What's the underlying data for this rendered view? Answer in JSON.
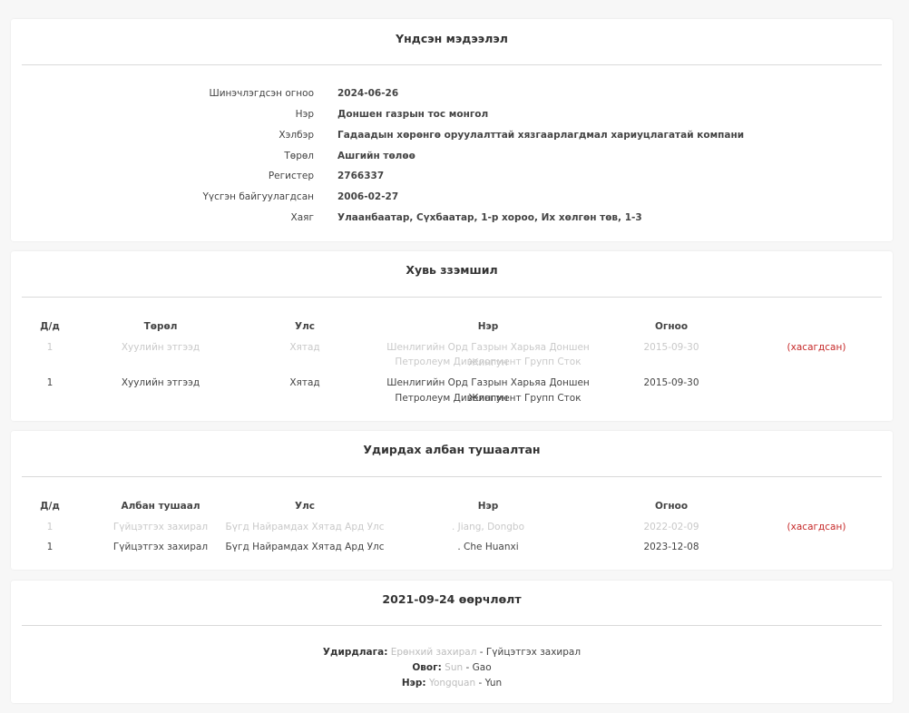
{
  "basic": {
    "title": "Үндсэн мэдээлэл",
    "rows": [
      {
        "label": "Шинэчлэгдсэн огноо",
        "value": "2024-06-26"
      },
      {
        "label": "Нэр",
        "value": "Доншен газрын тос монгол"
      },
      {
        "label": "Хэлбэр",
        "value": "Гадаадын хөрөнгө оруулалттай хязгаарлагдмал хариуцлагатай компани"
      },
      {
        "label": "Төрөл",
        "value": "Ашгийн төлөө"
      },
      {
        "label": "Регистер",
        "value": "2766337"
      },
      {
        "label": "Үүсгэн байгуулагдсан",
        "value": "2006-02-27"
      },
      {
        "label": "Хаяг",
        "value": "Улаанбаатар, Сүхбаатар, 1-р хороо, Их хөлгөн төв, 1-3"
      }
    ]
  },
  "ownership": {
    "title": "Хувь ззэмшил",
    "headers": {
      "dd": "Д/д",
      "type": "Төрөл",
      "country": "Улс",
      "name": "Нэр",
      "date": "Огноо"
    },
    "rows": [
      {
        "dd": "1",
        "type": "Хуулийн этгээд",
        "country": "Хятад",
        "name1": "Шенлигийн Орд Газрын Харьяа Доншен Жингун",
        "name2": "Петролеум Дивелопмент Групп Сток",
        "date": "2015-09-30",
        "flag": "(хасагдсан)",
        "removed": true
      },
      {
        "dd": "1",
        "type": "Хуулийн этгээд",
        "country": "Хятад",
        "name1": "Шенлигийн Орд Газрын Харьяа Доншен Жингун",
        "name2": "Петролеум Дивелопмент Групп Сток",
        "date": "2015-09-30",
        "flag": "",
        "removed": false
      }
    ]
  },
  "officials": {
    "title": "Удирдах албан тушаалтан",
    "headers": {
      "dd": "Д/д",
      "position": "Албан тушаал",
      "country": "Улс",
      "name": "Нэр",
      "date": "Огноо"
    },
    "rows": [
      {
        "dd": "1",
        "position": "Гүйцэтгэх захирал",
        "country": "Бүгд Найрамдах Хятад Ард Улс",
        "name": ". Jiang, Dongbo",
        "date": "2022-02-09",
        "flag": "(хасагдсан)",
        "removed": true
      },
      {
        "dd": "1",
        "position": "Гүйцэтгэх захирал",
        "country": "Бүгд Найрамдах Хятад Ард Улс",
        "name": ". Che Huanxi",
        "date": "2023-12-08",
        "flag": "",
        "removed": false
      }
    ]
  },
  "change": {
    "title": "2021-09-24 өөрчлөлт",
    "lines": [
      {
        "key": "Удирдлага:",
        "old": "Ерөнхий захирал",
        "sep": "-",
        "new": "Гүйцэтгэх захирал"
      },
      {
        "key": "Овог:",
        "old": "Sun",
        "sep": "-",
        "new": "Gao"
      },
      {
        "key": "Нэр:",
        "old": "Yongquan",
        "sep": "-",
        "new": "Yun"
      }
    ]
  },
  "colors": {
    "background": "#f7f7f7",
    "card": "#ffffff",
    "removed_text": "#c9c9c9",
    "removed_flag": "#c62828",
    "separator": "#d9d9d9"
  }
}
